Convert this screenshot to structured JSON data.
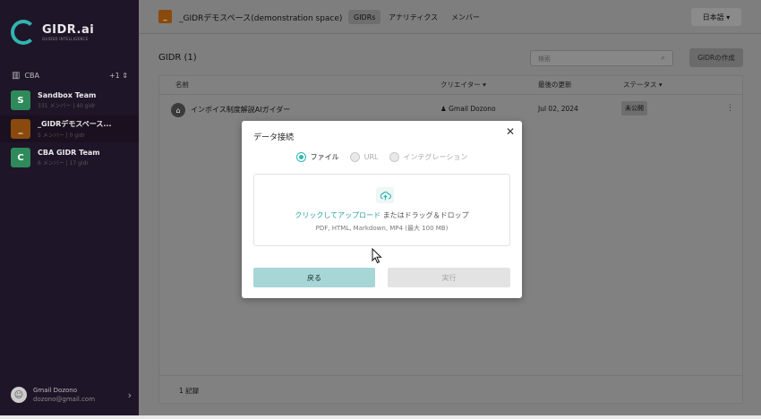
{
  "brand": {
    "name": "GIDR.ai",
    "tagline": "GUIDED INTELLIGENCE"
  },
  "sidebar": {
    "org_name": "CBA",
    "org_count": "+1",
    "teams": [
      {
        "initial": "S",
        "name": "Sandbox Team",
        "sub": "331 メンバー | 40 gidr",
        "color": "#2e8a5a"
      },
      {
        "initial": "_",
        "name": "_GIDRデモスペース...",
        "sub": "5 メンバー | 0 gidr",
        "color": "#8a4a0e"
      },
      {
        "initial": "C",
        "name": "CBA GIDR Team",
        "sub": "6 メンバー | 17 gidr",
        "color": "#2e8a5a"
      }
    ],
    "user": {
      "name": "Gmail Dozono",
      "email": "dozono@gmail.com"
    }
  },
  "topbar": {
    "workspace_icon": "_",
    "workspace_name": "_GIDRデモスペース(demonstration space)",
    "tabs": [
      "GIDRs",
      "アナリティクス",
      "メンバー"
    ],
    "language": "日本語"
  },
  "main": {
    "title": "GIDR (1)",
    "search_placeholder": "検索",
    "create_button": "GIDRの作成",
    "columns": [
      "名前",
      "クリエイター",
      "最後の更新",
      "ステータス"
    ],
    "rows": [
      {
        "name": "インボイス制度解説AIガイダー",
        "creator": "Gmail Dozono",
        "updated": "Jul 02, 2024",
        "status": "未公開"
      }
    ],
    "record_count": "1 記録"
  },
  "modal": {
    "title": "データ接続",
    "options": [
      "ファイル",
      "URL",
      "インテグレーション"
    ],
    "upload_link": "クリックしてアップロード",
    "upload_rest": " またはドラッグ＆ドロップ",
    "formats": "PDF, HTML, Markdown, MP4 (最大 100 MB)",
    "back_button": "戻る",
    "run_button": "実行"
  },
  "colors": {
    "accent": "#2fb5b0",
    "sidebar_bg": "#1f1528"
  }
}
